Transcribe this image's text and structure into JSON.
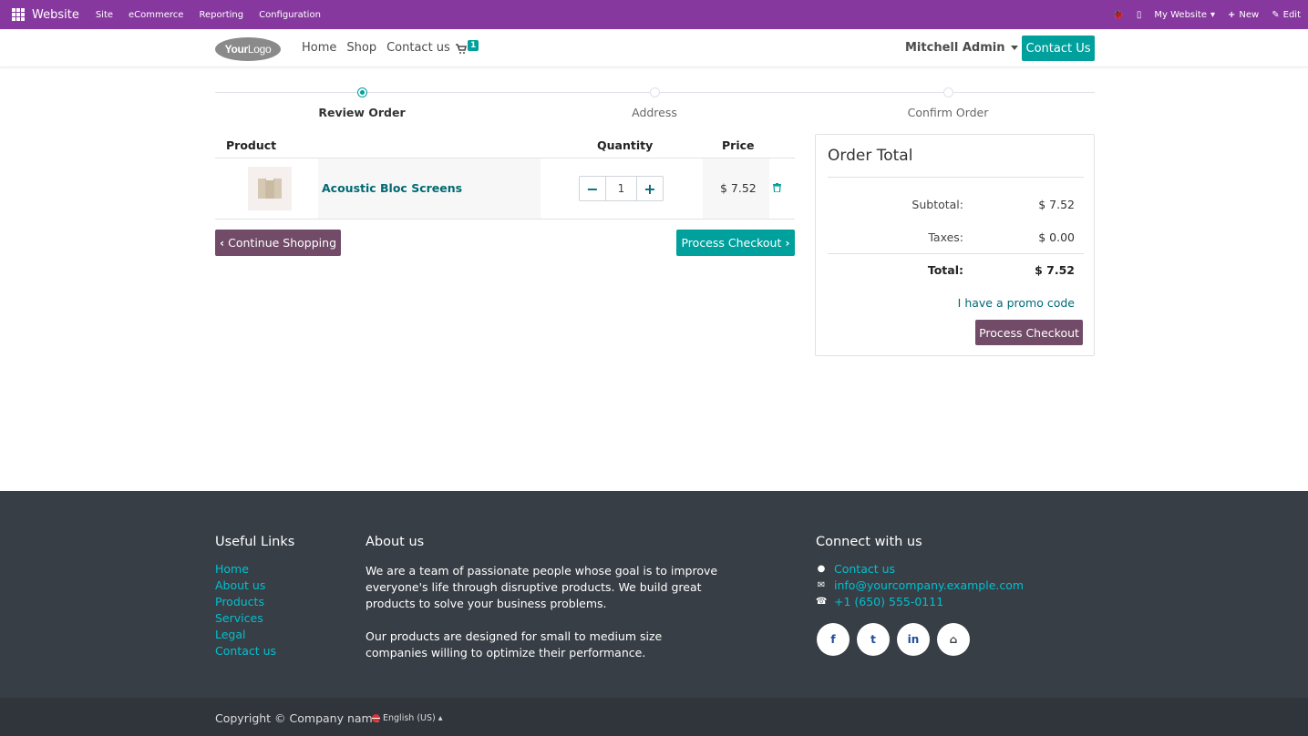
{
  "adminbar": {
    "brand": "Website",
    "menus": [
      "Site",
      "eCommerce",
      "Reporting",
      "Configuration"
    ],
    "right": {
      "site_selector": "My Website",
      "new_label": "New",
      "edit_label": "Edit"
    }
  },
  "header": {
    "logo_bold": "Your",
    "logo_light": "Logo",
    "nav": [
      "Home",
      "Shop",
      "Contact us"
    ],
    "cart_count": "1",
    "user": "Mitchell Admin",
    "contact_button": "Contact Us"
  },
  "wizard": {
    "steps": [
      {
        "label": "Review Order",
        "active": true
      },
      {
        "label": "Address",
        "active": false
      },
      {
        "label": "Confirm Order",
        "active": false
      }
    ]
  },
  "cart": {
    "headers": {
      "product": "Product",
      "quantity": "Quantity",
      "price": "Price"
    },
    "rows": [
      {
        "name": "Acoustic Bloc Screens",
        "quantity": "1",
        "price": "$ 7.52"
      }
    ],
    "continue_label": "Continue Shopping",
    "checkout_label": "Process Checkout"
  },
  "order_total": {
    "title": "Order Total",
    "subtotal_label": "Subtotal:",
    "subtotal": "$ 7.52",
    "taxes_label": "Taxes:",
    "taxes": "$ 0.00",
    "total_label": "Total:",
    "total": "$ 7.52",
    "promo_link": "I have a promo code",
    "checkout_label": "Process Checkout"
  },
  "footer": {
    "useful_links_title": "Useful Links",
    "useful_links": [
      "Home",
      "About us",
      "Products",
      "Services",
      "Legal",
      "Contact us"
    ],
    "about_title": "About us",
    "about_p1": "We are a team of passionate people whose goal is to improve everyone's life through disruptive products. We build great products to solve your business problems.",
    "about_p2": "Our products are designed for small to medium size companies willing to optimize their performance.",
    "connect_title": "Connect with us",
    "connect": {
      "contact": "Contact us",
      "email": "info@yourcompany.example.com",
      "phone": "+1 (650) 555-0111"
    },
    "social": [
      "facebook-icon",
      "twitter-icon",
      "linkedin-icon",
      "home-icon"
    ],
    "copyright": "Copyright © Company name",
    "language": "English (US)"
  },
  "colors": {
    "adminbar": "#87389f",
    "primary": "#00a09d",
    "secondary": "#714b67",
    "footer": "#383e45",
    "link": "#016a73"
  }
}
